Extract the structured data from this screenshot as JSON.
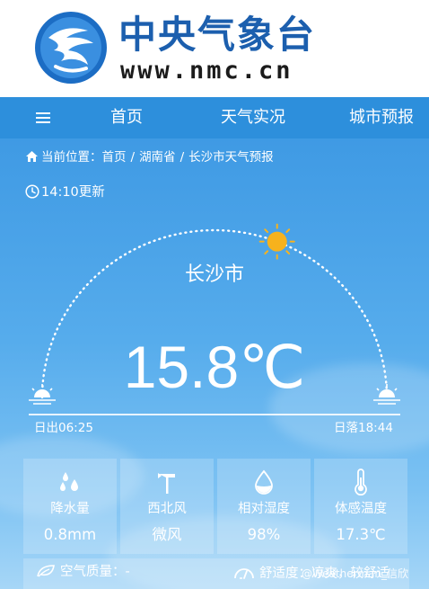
{
  "header": {
    "logo_cn": "中央气象台",
    "logo_url": "www.nmc.cn"
  },
  "nav": {
    "items": [
      {
        "label": "首页"
      },
      {
        "label": "天气实况"
      },
      {
        "label": "城市预报"
      }
    ]
  },
  "breadcrumb": {
    "prefix": "当前位置：",
    "items": [
      "首页",
      "湖南省",
      "长沙市天气预报"
    ],
    "separator": "/"
  },
  "update_time": "14:10更新",
  "weather": {
    "city": "长沙市",
    "temperature": "15.8℃",
    "sunrise": "日出06:25",
    "sunset": "日落18:44",
    "sun_progress": 0.62
  },
  "cards": [
    {
      "icon": "rain-drops-icon",
      "label": "降水量",
      "value": "0.8mm"
    },
    {
      "icon": "wind-vane-icon",
      "label": "西北风",
      "value": "微风"
    },
    {
      "icon": "humidity-drop-icon",
      "label": "相对湿度",
      "value": "98%"
    },
    {
      "icon": "thermometer-icon",
      "label": "体感温度",
      "value": "17.3℃"
    }
  ],
  "bottom": {
    "air_quality": "空气质量：-",
    "comfort": "舒适度：凉爽，较舒适"
  },
  "watermark": "@Weatherman_信欣",
  "colors": {
    "brand_blue": "#1c5fae",
    "nav_bg": "#2d8fdc",
    "sun": "#f7b21d"
  }
}
